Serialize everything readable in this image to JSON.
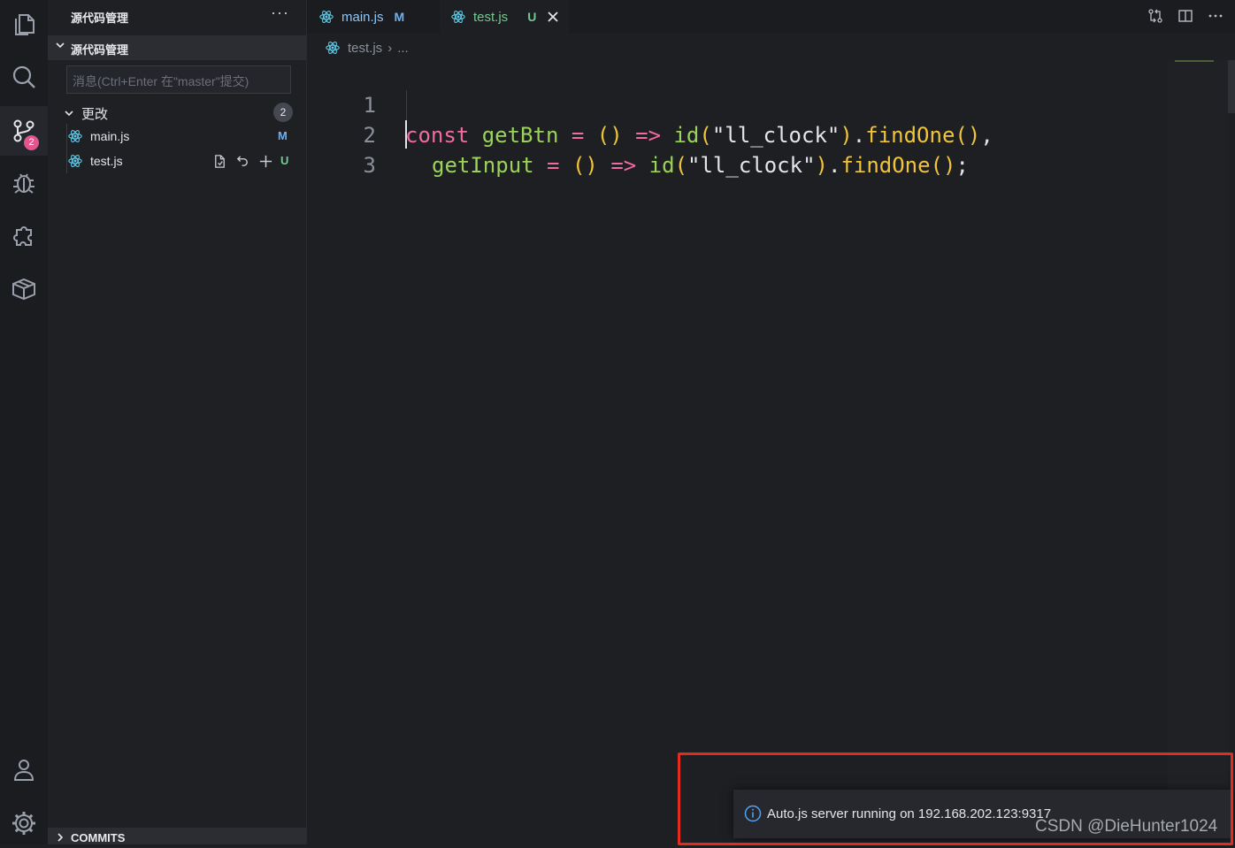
{
  "activity_bar": {
    "items": [
      {
        "icon": "files-icon"
      },
      {
        "icon": "search-icon"
      },
      {
        "icon": "source-control-icon",
        "badge": "2"
      },
      {
        "icon": "debug-icon"
      },
      {
        "icon": "extensions-icon"
      },
      {
        "icon": "package-icon"
      },
      {
        "icon": "account-icon"
      },
      {
        "icon": "settings-gear-icon"
      }
    ]
  },
  "sidebar": {
    "title": "源代码管理",
    "more": "···",
    "section_label": "源代码管理",
    "commit_placeholder": "消息(Ctrl+Enter 在\"master\"提交)",
    "changes": {
      "label": "更改",
      "count": "2",
      "files": [
        {
          "name": "main.js",
          "status": "M"
        },
        {
          "name": "test.js",
          "status": "U"
        }
      ]
    },
    "commits_label": "COMMITS"
  },
  "tabs": [
    {
      "name": "main.js",
      "flag": "M"
    },
    {
      "name": "test.js",
      "flag": "U"
    }
  ],
  "breadcrumb": {
    "file": "test.js",
    "more": "..."
  },
  "editor": {
    "line_numbers": [
      "1",
      "2",
      "3"
    ],
    "line1": {
      "kw": "const",
      "name": "getBtn",
      "eq": "=",
      "parens": "()",
      "arrow": "=>",
      "fn": "id",
      "open": "(",
      "arg": "\"ll_clock\"",
      "close": ")",
      "dot": ".",
      "method": "findOne",
      "call": "()",
      "end": ","
    },
    "line2": {
      "name": "getInput",
      "eq": "=",
      "parens": "()",
      "arrow": "=>",
      "fn": "id",
      "open": "(",
      "arg": "\"ll_clock\"",
      "close": ")",
      "dot": ".",
      "method": "findOne",
      "call": "()",
      "end": ";"
    }
  },
  "notification": {
    "message": "Auto.js server running on 192.168.202.123:9317"
  },
  "watermark": "CSDN @DieHunter1024",
  "colors": {
    "keyword": "#f06aa4",
    "identifier": "#9bd35a",
    "bracket": "#f0c43b",
    "modified": "#6ab0f3",
    "untracked": "#73c991",
    "highlight": "#e52a1f"
  }
}
